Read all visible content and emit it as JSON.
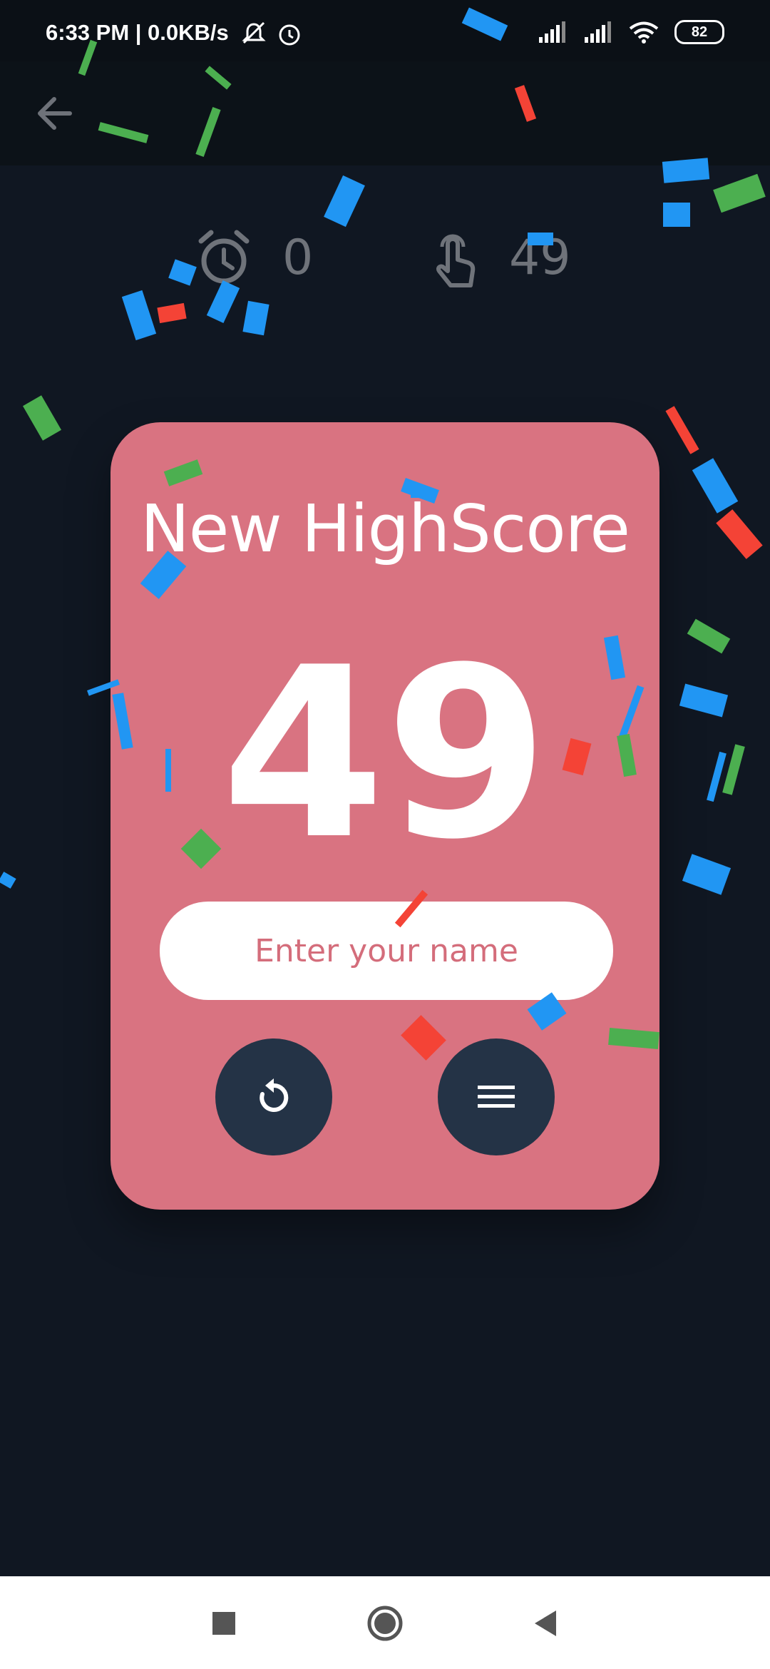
{
  "status_bar": {
    "left_text": "6:33 PM | 0.0KB/s",
    "battery": "82",
    "icons": [
      "mute-bell-icon",
      "alarm-icon",
      "signal-icon",
      "signal-icon",
      "wifi-icon",
      "battery-icon"
    ]
  },
  "app_bar": {
    "back_icon": "arrow-left-icon"
  },
  "stats": {
    "time_icon": "alarm-clock-icon",
    "time_value": "0",
    "taps_icon": "tap-finger-icon",
    "taps_value": "49"
  },
  "card": {
    "title": "New HighScore",
    "score": "49",
    "name_placeholder": "Enter your name",
    "restart_icon": "restart-icon",
    "menu_icon": "menu-icon"
  },
  "nav_bar": {
    "icons": [
      "recent-apps-icon",
      "home-icon",
      "back-triangle-icon"
    ]
  },
  "colors": {
    "background": "#101722",
    "card": "#d97381",
    "button": "#243346",
    "confetti": [
      "#2196f3",
      "#f44336",
      "#4caf50"
    ]
  }
}
